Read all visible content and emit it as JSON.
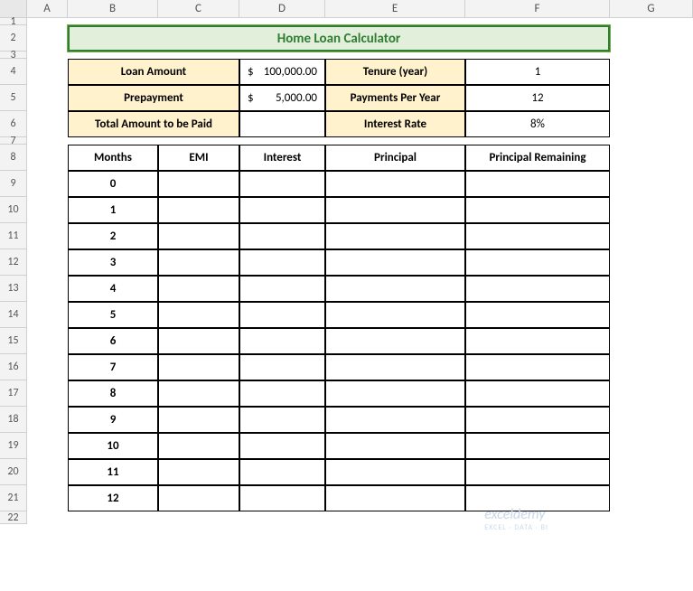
{
  "columns": [
    "A",
    "B",
    "C",
    "D",
    "E",
    "F",
    "G"
  ],
  "rows": [
    "1",
    "2",
    "3",
    "4",
    "5",
    "6",
    "7",
    "8",
    "9",
    "10",
    "11",
    "12",
    "13",
    "14",
    "15",
    "16",
    "17",
    "18",
    "19",
    "20",
    "21",
    "22"
  ],
  "title": "Home Loan Calculator",
  "params": {
    "loan_amount_label": "Loan Amount",
    "loan_amount_currency": "$",
    "loan_amount_value": "100,000.00",
    "tenure_label": "Tenure (year)",
    "tenure_value": "1",
    "prepayment_label": "Prepayment",
    "prepayment_currency": "$",
    "prepayment_value": "5,000.00",
    "ppy_label": "Payments Per Year",
    "ppy_value": "12",
    "total_label": "Total Amount to be Paid",
    "total_value": "",
    "rate_label": "Interest Rate",
    "rate_value": "8%"
  },
  "table": {
    "headers": {
      "months": "Months",
      "emi": "EMI",
      "interest": "Interest",
      "principal": "Principal",
      "remaining": "Principal Remaining"
    },
    "rows": [
      {
        "months": "0",
        "emi": "",
        "interest": "",
        "principal": "",
        "remaining": ""
      },
      {
        "months": "1",
        "emi": "",
        "interest": "",
        "principal": "",
        "remaining": ""
      },
      {
        "months": "2",
        "emi": "",
        "interest": "",
        "principal": "",
        "remaining": ""
      },
      {
        "months": "3",
        "emi": "",
        "interest": "",
        "principal": "",
        "remaining": ""
      },
      {
        "months": "4",
        "emi": "",
        "interest": "",
        "principal": "",
        "remaining": ""
      },
      {
        "months": "5",
        "emi": "",
        "interest": "",
        "principal": "",
        "remaining": ""
      },
      {
        "months": "6",
        "emi": "",
        "interest": "",
        "principal": "",
        "remaining": ""
      },
      {
        "months": "7",
        "emi": "",
        "interest": "",
        "principal": "",
        "remaining": ""
      },
      {
        "months": "8",
        "emi": "",
        "interest": "",
        "principal": "",
        "remaining": ""
      },
      {
        "months": "9",
        "emi": "",
        "interest": "",
        "principal": "",
        "remaining": ""
      },
      {
        "months": "10",
        "emi": "",
        "interest": "",
        "principal": "",
        "remaining": ""
      },
      {
        "months": "11",
        "emi": "",
        "interest": "",
        "principal": "",
        "remaining": ""
      },
      {
        "months": "12",
        "emi": "",
        "interest": "",
        "principal": "",
        "remaining": ""
      }
    ]
  },
  "watermark": {
    "main": "exceldemy",
    "sub": "EXCEL · DATA · BI"
  }
}
